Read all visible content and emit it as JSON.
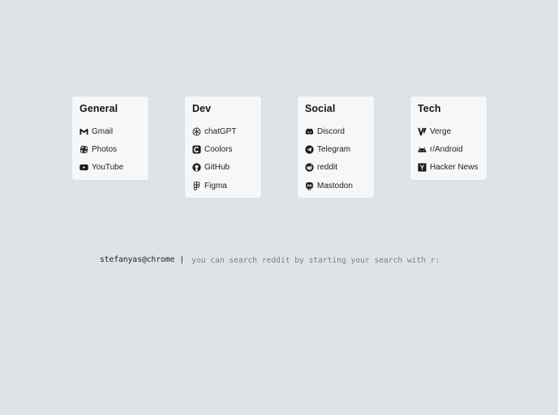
{
  "categories": [
    {
      "title": "General",
      "links": [
        {
          "label": "Gmail",
          "icon": "gmail-icon"
        },
        {
          "label": "Photos",
          "icon": "photos-icon"
        },
        {
          "label": "YouTube",
          "icon": "youtube-icon"
        }
      ]
    },
    {
      "title": "Dev",
      "links": [
        {
          "label": "chatGPT",
          "icon": "openai-icon"
        },
        {
          "label": "Coolors",
          "icon": "coolors-icon"
        },
        {
          "label": "GitHub",
          "icon": "github-icon"
        },
        {
          "label": "Figma",
          "icon": "figma-icon"
        }
      ]
    },
    {
      "title": "Social",
      "links": [
        {
          "label": "Discord",
          "icon": "discord-icon"
        },
        {
          "label": "Telegram",
          "icon": "telegram-icon"
        },
        {
          "label": "reddit",
          "icon": "reddit-icon"
        },
        {
          "label": "Mastodon",
          "icon": "mastodon-icon"
        }
      ]
    },
    {
      "title": "Tech",
      "links": [
        {
          "label": "Verge",
          "icon": "verge-icon"
        },
        {
          "label": "r/Android",
          "icon": "android-icon"
        },
        {
          "label": "Hacker News",
          "icon": "hackernews-icon"
        }
      ]
    }
  ],
  "prompt": {
    "user": "stefanyas@chrome",
    "separator": "|",
    "placeholder": "you can search reddit by starting your search with r:"
  },
  "colors": {
    "background": "#dee3e5",
    "card": "#f5f7f8",
    "text": "#1c1c1c",
    "placeholder": "#7d8082"
  }
}
